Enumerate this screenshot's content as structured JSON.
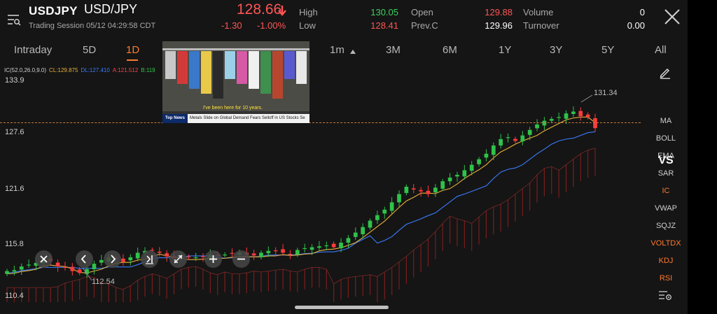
{
  "header": {
    "symbol": "USDJPY",
    "pair": "USD/JPY",
    "session": "Trading Session  05/12 04:29:58 CDT",
    "price": "128.66",
    "change": "-1.30",
    "change_pct": "-1.00%",
    "high_label": "High",
    "high": "130.05",
    "low_label": "Low",
    "low": "128.41",
    "open_label": "Open",
    "open": "129.88",
    "prevc_label": "Prev.C",
    "prevc": "129.96",
    "volume_label": "Volume",
    "volume": "0",
    "turnover_label": "Turnover",
    "turnover": "0.00",
    "colors": {
      "up": "#3fcf5f",
      "down": "#ff5555"
    }
  },
  "tabs": [
    "Intraday",
    "5D",
    "1D",
    "1m",
    "3M",
    "6M",
    "1Y",
    "3Y",
    "5Y",
    "All"
  ],
  "active_tab": "1D",
  "chart": {
    "legend": {
      "ic": "IC(52.0,26.0,9.0)",
      "cl": "CL:129.875",
      "dl": "DL:127.410",
      "a": "A:121.512",
      "b": "B:119"
    },
    "y_labels": [
      "133.9",
      "127.6",
      "121.6",
      "115.8",
      "110.4"
    ],
    "annotation_high": "131.34",
    "annotation_low": "112.54",
    "colors": {
      "cl": "#e8b13a",
      "dl": "#3a7cff",
      "a": "#ff4444",
      "b": "#2fc24a",
      "dash": "#c87a3a"
    }
  },
  "chart_data": {
    "type": "candlestick",
    "title": "USD/JPY",
    "ylim": [
      110.4,
      133.9
    ],
    "ticks": [
      133.9,
      127.6,
      121.6,
      115.8,
      110.4
    ],
    "close_path": [
      113.1,
      113.2,
      113.6,
      113.8,
      114.0,
      114.3,
      114.2,
      113.6,
      113.5,
      113.1,
      112.9,
      113.3,
      113.9,
      114.3,
      114.6,
      114.4,
      114.1,
      114.6,
      115.1,
      115.3,
      115.4,
      115.1,
      114.7,
      114.5,
      114.8,
      114.6,
      114.6,
      114.7,
      114.9,
      114.8,
      114.9,
      115.0,
      115.1,
      114.9,
      114.8,
      115.1,
      115.3,
      115.3,
      115.1,
      114.9,
      115.4,
      115.6,
      115.7,
      115.8,
      115.9,
      115.7,
      116.2,
      116.7,
      117.3,
      117.9,
      118.6,
      119.2,
      119.8,
      120.6,
      121.5,
      122.3,
      122.0,
      121.8,
      121.5,
      122.2,
      122.9,
      123.3,
      123.6,
      124.1,
      124.7,
      125.3,
      125.9,
      126.8,
      127.5,
      127.7,
      127.3,
      127.9,
      128.5,
      129.1,
      129.5,
      129.7,
      129.9,
      130.3,
      130.5,
      130.0,
      129.9,
      128.7
    ],
    "series": [
      {
        "name": "CL",
        "last": 129.875
      },
      {
        "name": "DL",
        "last": 127.41
      },
      {
        "name": "A",
        "last": 121.512
      },
      {
        "name": "B",
        "last": 119
      }
    ]
  },
  "video": {
    "caption": "I've been here for 10 years.",
    "tag": "Top News",
    "ticker": "Metals Slide on Global Demand Fears        Selloff in US Stocks Se"
  },
  "indicators": [
    "MA",
    "BOLL",
    "EMA",
    "SAR",
    "IC",
    "VWAP",
    "SQJZ",
    "VOLTDX",
    "KDJ",
    "RSI"
  ],
  "indicators_active": [
    "IC",
    "VOLTDX",
    "KDJ",
    "RSI"
  ],
  "vs_label": "VS"
}
